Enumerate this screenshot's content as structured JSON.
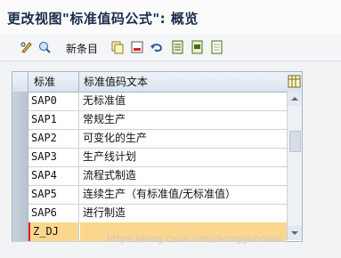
{
  "window": {
    "title": "更改视图\"标准值码公式\": 概览"
  },
  "toolbar": {
    "new_entries_label": "新条目"
  },
  "table": {
    "columns": [
      "标准",
      "标准值码文本"
    ],
    "rows": [
      {
        "code": "SAP0",
        "text": "无标准值"
      },
      {
        "code": "SAP1",
        "text": "常规生产"
      },
      {
        "code": "SAP2",
        "text": "可变化的生产"
      },
      {
        "code": "SAP3",
        "text": "生产线计划"
      },
      {
        "code": "SAP4",
        "text": "流程式制造"
      },
      {
        "code": "SAP5",
        "text": "连续生产（有标准值/无标准值）"
      },
      {
        "code": "SAP6",
        "text": "进行制造"
      },
      {
        "code": "Z_DJ",
        "text": ""
      }
    ]
  },
  "watermark": "https://blog.csdn.net/zhongguomao",
  "colors": {
    "header": "#dce7f2",
    "highlight_row": "#fbd68e",
    "title": "#1a2b4a"
  }
}
